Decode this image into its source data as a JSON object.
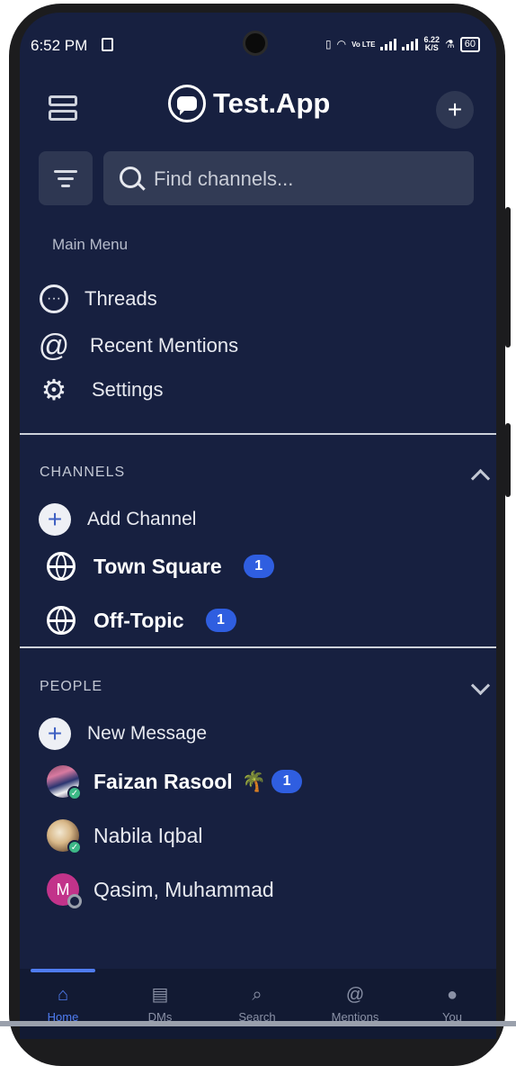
{
  "status_bar": {
    "time": "6:52 PM",
    "network_label": "Vo LTE",
    "speed_value": "6.22",
    "speed_unit": "K/S",
    "battery": "60"
  },
  "header": {
    "app_name": "Test.App",
    "add_button": "+"
  },
  "search": {
    "placeholder": "Find channels..."
  },
  "main_menu": {
    "label": "Main Menu",
    "items": [
      {
        "label": "Threads",
        "icon": "threads-icon"
      },
      {
        "label": "Recent Mentions",
        "icon": "at-sign-icon"
      },
      {
        "label": "Settings",
        "icon": "gear-icon"
      }
    ]
  },
  "channels": {
    "header": "CHANNELS",
    "add_label": "Add Channel",
    "items": [
      {
        "name": "Town Square",
        "badge": "1"
      },
      {
        "name": "Off-Topic",
        "badge": "1"
      }
    ]
  },
  "people": {
    "header": "PEOPLE",
    "new_message_label": "New Message",
    "items": [
      {
        "name": "Faizan Rasool",
        "emoji": "🌴",
        "badge": "1",
        "status": "online"
      },
      {
        "name": "Nabila Iqbal",
        "status": "online"
      },
      {
        "name": "Qasim, Muhammad",
        "initial": "M",
        "status": "offline"
      }
    ]
  },
  "tabs": [
    {
      "label": "Home",
      "icon": "home-icon"
    },
    {
      "label": "DMs",
      "icon": "chat-icon"
    },
    {
      "label": "Search",
      "icon": "search-icon"
    },
    {
      "label": "Mentions",
      "icon": "at-sign-icon"
    },
    {
      "label": "You",
      "icon": "person-icon"
    }
  ],
  "colors": {
    "background": "#172040",
    "accent": "#4f7cf0",
    "badge": "#2f5ee0",
    "online": "#3db887"
  }
}
